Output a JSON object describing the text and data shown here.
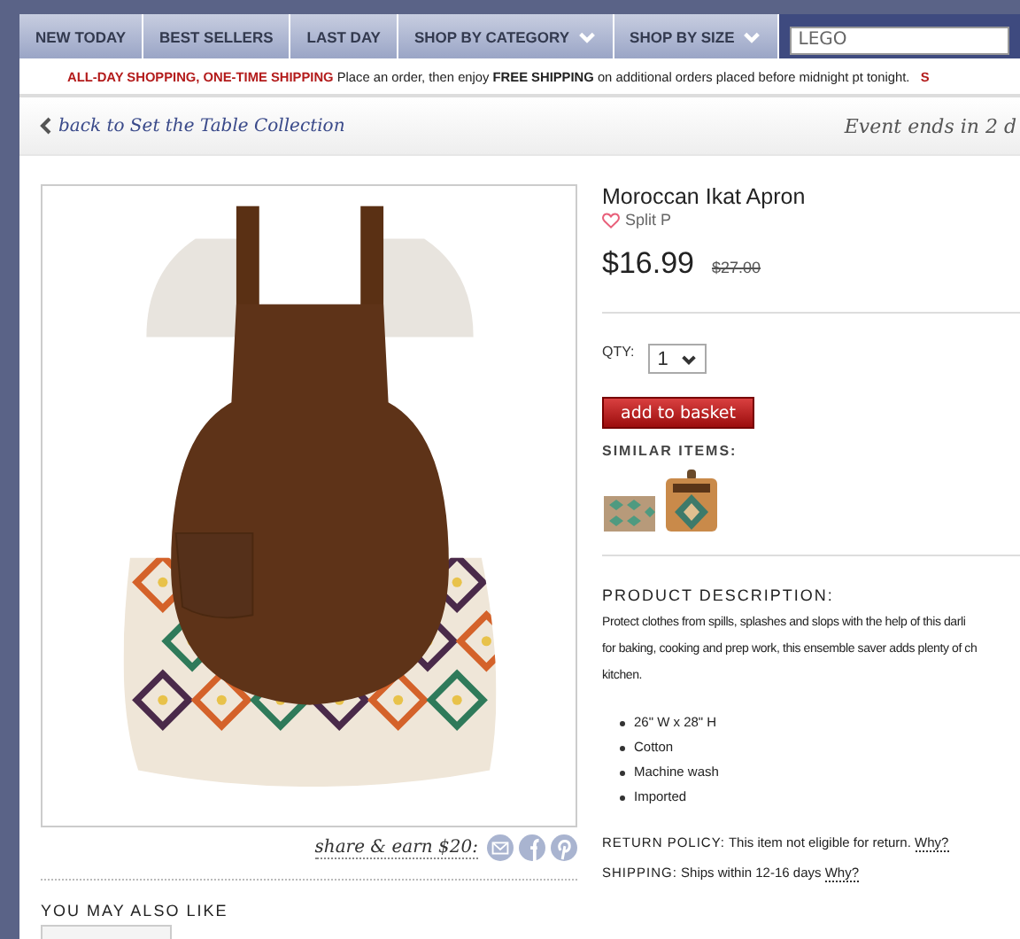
{
  "nav": {
    "tabs": [
      {
        "label": "NEW TODAY",
        "dropdown": false
      },
      {
        "label": "BEST SELLERS",
        "dropdown": false
      },
      {
        "label": "LAST DAY",
        "dropdown": false
      },
      {
        "label": "SHOP BY CATEGORY",
        "dropdown": true
      },
      {
        "label": "SHOP BY SIZE",
        "dropdown": true
      }
    ],
    "search": {
      "value": "LEGO"
    }
  },
  "promo": {
    "headline": "ALL-DAY SHOPPING, ONE-TIME SHIPPING",
    "text": "Place an order, then enjoy **FREE SHIPPING** on additional orders placed before midnight pt tonight.",
    "tail": "S"
  },
  "back_link": "back to Set the Table Collection",
  "event_timer": "Event ends in 2 d",
  "share": {
    "label": "share & earn $20:"
  },
  "product": {
    "name": "Moroccan Ikat Apron",
    "brand": "Split P",
    "favorite": false,
    "price": "$16.99",
    "original_price": "$27.00",
    "qty_label": "QTY:",
    "qty": "1",
    "add_button": "add to basket",
    "similar_label": "SIMILAR ITEMS:",
    "description_label": "PRODUCT DESCRIPTION:",
    "description_lines": [
      "Protect clothes from spills, splashes and slops with the help of this darli",
      "for baking, cooking and prep work, this ensemble saver adds plenty of ch",
      "kitchen."
    ],
    "features": [
      "26\" W x 28\" H",
      "Cotton",
      "Machine wash",
      "Imported"
    ],
    "return_policy": {
      "label": "RETURN POLICY:",
      "text": "This item not eligible for return.",
      "link": "Why?"
    },
    "shipping": {
      "label": "SHIPPING:",
      "text": "Ships within 12-16 days",
      "link": "Why?"
    }
  },
  "also_like": {
    "title": "YOU MAY ALSO LIKE"
  }
}
